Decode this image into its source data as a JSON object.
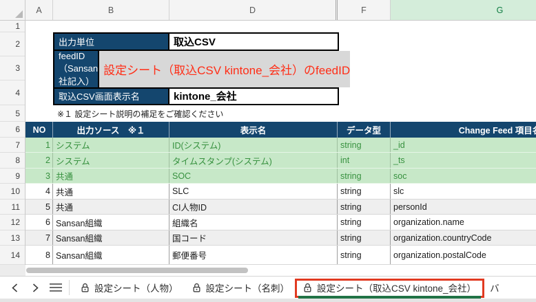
{
  "columns": {
    "letters": [
      "A",
      "B",
      "D",
      "F",
      "G"
    ],
    "selected": "G"
  },
  "row_numbers": [
    "1",
    "2",
    "3",
    "4",
    "5",
    "6",
    "7",
    "8",
    "9",
    "10",
    "11",
    "12",
    "13",
    "14"
  ],
  "info_table": {
    "rows": [
      {
        "label": "出力単位",
        "value": "取込CSV"
      },
      {
        "label": "feedID（Sansan社記入）",
        "value": "設定シート（取込CSV kintone_会社）のfeedID"
      },
      {
        "label": "取込CSV画面表示名",
        "value": "kintone_会社"
      }
    ]
  },
  "note": "※１ 設定シート説明の補足をご確認ください",
  "data_table": {
    "headers": {
      "no": "NO",
      "source": "出力ソース　※１",
      "display": "表示名",
      "type": "データ型",
      "feed": "Change Feed 項目名"
    },
    "rows": [
      {
        "no": "1",
        "source": "システム",
        "display": "ID(システム)",
        "type": "string",
        "feed": "_id"
      },
      {
        "no": "2",
        "source": "システム",
        "display": "タイムスタンプ(システム)",
        "type": "int",
        "feed": "_ts"
      },
      {
        "no": "3",
        "source": "共通",
        "display": "SOC",
        "type": "string",
        "feed": "soc"
      },
      {
        "no": "4",
        "source": "共通",
        "display": "SLC",
        "type": "string",
        "feed": "slc"
      },
      {
        "no": "5",
        "source": "共通",
        "display": "CI人物ID",
        "type": "string",
        "feed": "personId"
      },
      {
        "no": "6",
        "source": "Sansan組織",
        "display": "組織名",
        "type": "string",
        "feed": "organization.name"
      },
      {
        "no": "7",
        "source": "Sansan組織",
        "display": "国コード",
        "type": "string",
        "feed": "organization.countryCode"
      },
      {
        "no": "8",
        "source": "Sansan組織",
        "display": "郵便番号",
        "type": "string",
        "feed": "organization.postalCode"
      }
    ]
  },
  "tab_bar": {
    "tabs": [
      {
        "label": "設定シート（人物）",
        "locked": true,
        "active": false
      },
      {
        "label": "設定シート（名刺）",
        "locked": true,
        "active": false
      },
      {
        "label": "設定シート（取込CSV kintone_会社）",
        "locked": true,
        "active": true,
        "highlighted": true
      },
      {
        "label": "バ",
        "locked": false,
        "active": false
      }
    ]
  },
  "colors": {
    "header_blue": "#14466e",
    "green_row_bg": "#c7e8c8",
    "green_row_text": "#37913f",
    "banded_gray": "#efefef",
    "cell_fill_gray": "#d8d8d8",
    "red_text": "#ff2d16",
    "red_annotation": "#e13a21",
    "active_tab_green": "#217346",
    "selected_col_bg": "#d4edda",
    "selected_col_text": "#0f7c42"
  }
}
